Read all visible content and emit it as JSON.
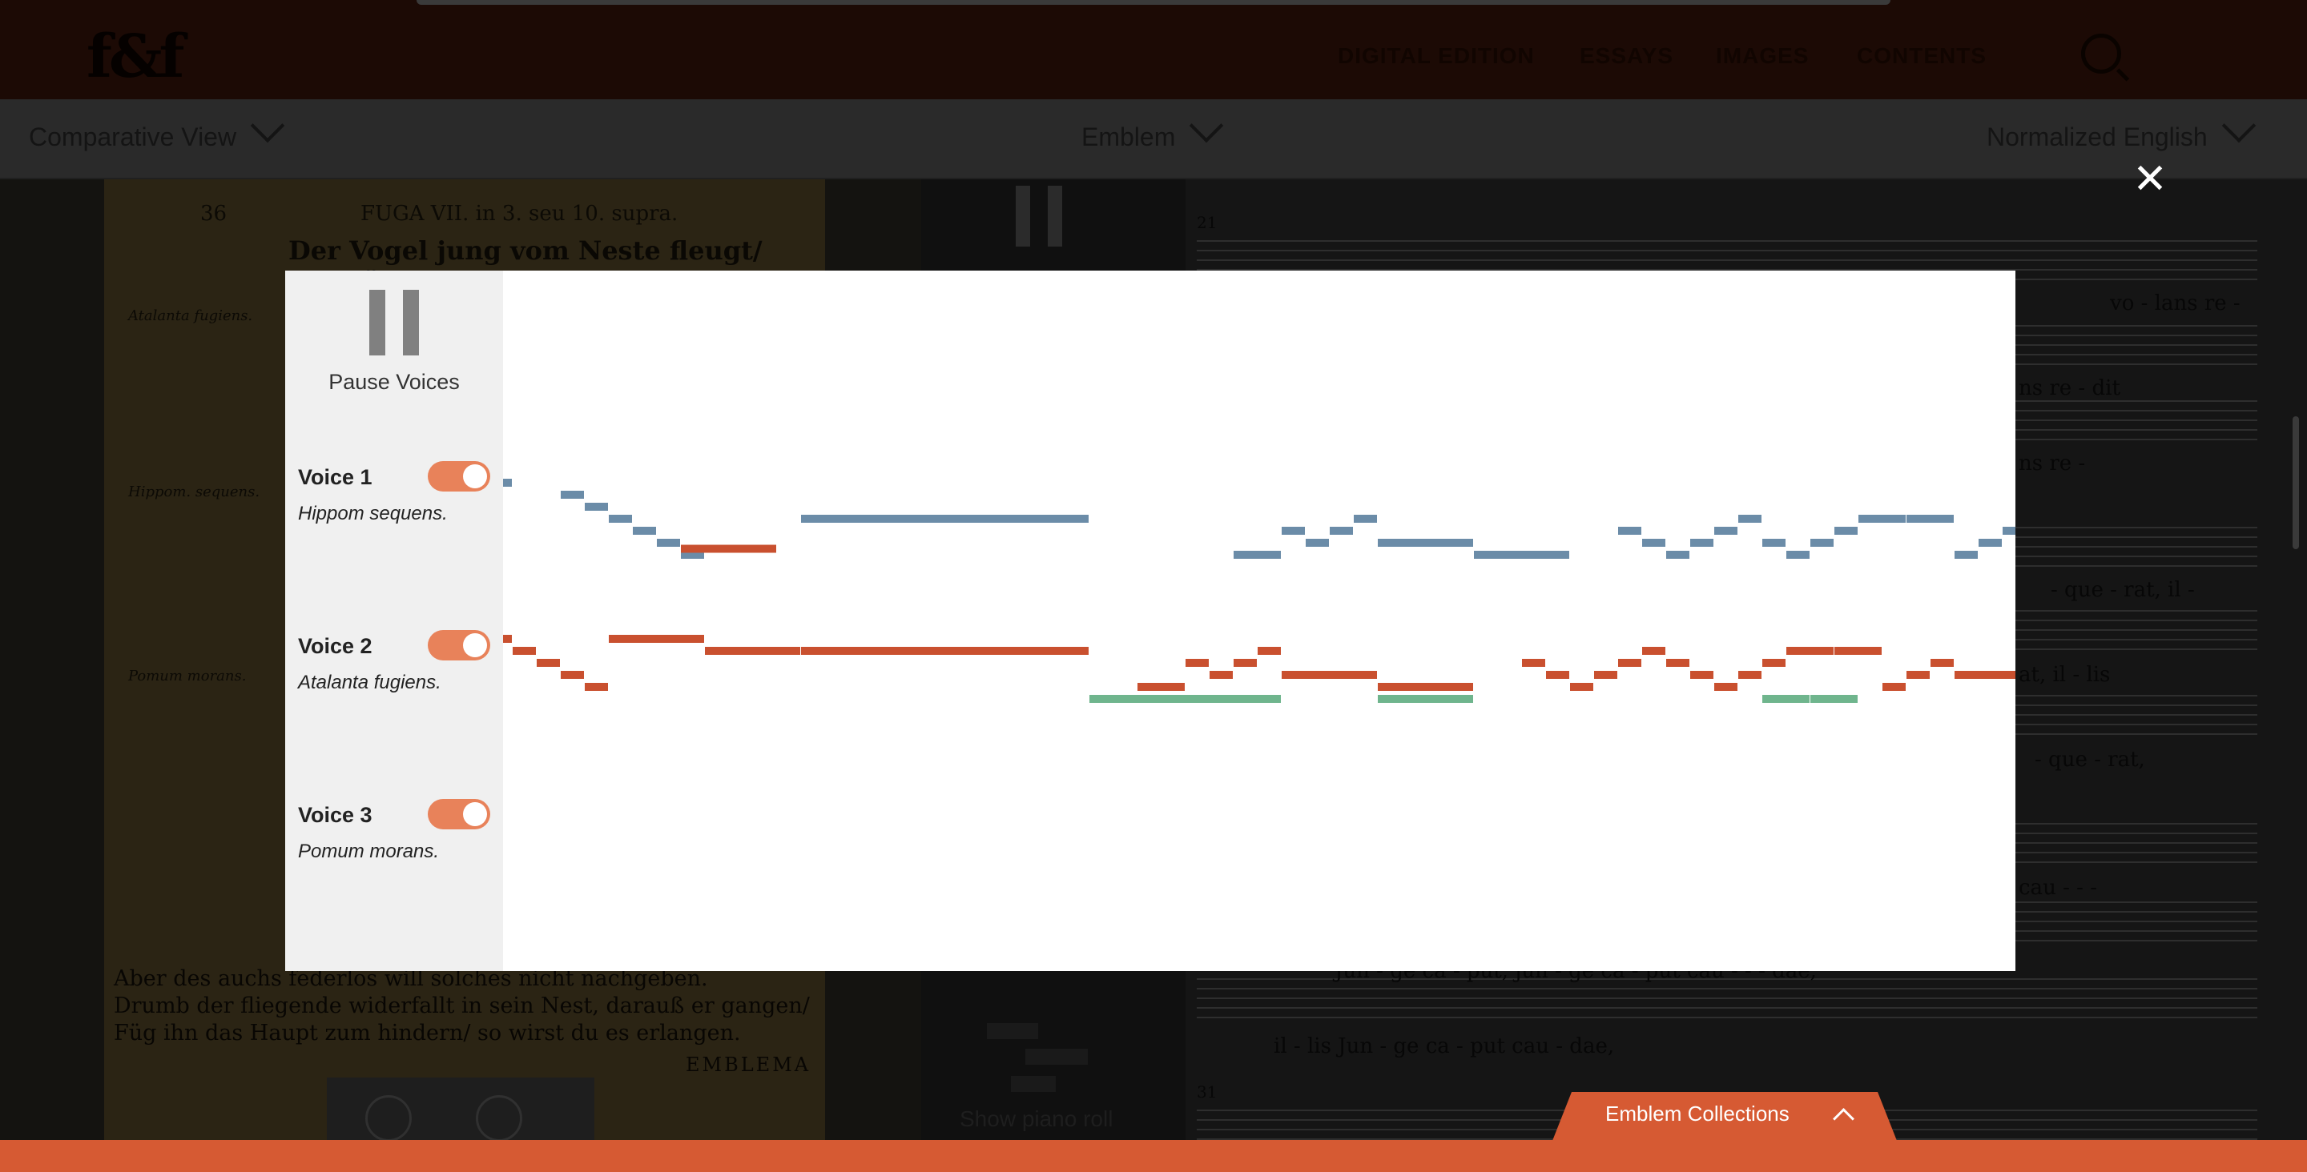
{
  "app": {
    "logo": "f&f",
    "nav": [
      "DIGITAL EDITION",
      "ESSAYS",
      "IMAGES",
      "CONTENTS"
    ]
  },
  "toolbar": {
    "view_select": "Comparative View",
    "section_select": "Emblem",
    "language_select": "Normalized English"
  },
  "manuscript": {
    "header": "FUGA VII. in 3. seu 10. supra.",
    "title_line": "Der Vogel jung vom Neste fleugt/ und fällt",
    "page_number": "36",
    "emblema": "EMBLEMA",
    "voice_labels": [
      "Atalanta fugiens.",
      "Hippom. sequens.",
      "Pomum morans."
    ],
    "verse_lines": [
      "Aber des auchs federlos will solches nicht nachgeben.",
      "Drumb der fliegende widerfallt in sein Nest, darauß er gangen/",
      "Füg ihn das Haupt zum hindern/ so wirst du es erlangen."
    ]
  },
  "score": {
    "measure_numbers": [
      "21",
      "31"
    ],
    "lyric_lines": [
      "vo - lans re -",
      "ns re - dit",
      "ns re -",
      "- que - rat, il -",
      "at, il - lis",
      "- que - rat,",
      "cau - - -",
      "Jun - ge ca - put, jun - ge ca - put cau - - - dae,",
      "il - lis Jun - ge ca - put cau - dae,"
    ]
  },
  "piano_roll_toggle": "Show piano roll",
  "footer": {
    "collections": "Emblem Collections"
  },
  "modal": {
    "pause_label": "Pause Voices",
    "voices": [
      {
        "name": "Voice 1",
        "subtitle": "Hippom sequens.",
        "enabled": true,
        "color": "#6b8ca8"
      },
      {
        "name": "Voice 2",
        "subtitle": "Atalanta fugiens.",
        "enabled": true,
        "color": "#c9502f"
      },
      {
        "name": "Voice 3",
        "subtitle": "Pomum morans.",
        "enabled": true,
        "color": "#6fb58d"
      }
    ]
  },
  "chart_data": {
    "type": "piano-roll",
    "time_unit": "eighth",
    "pitch_unit": "diatonic step (higher = higher pitch)",
    "series": [
      {
        "name": "Voice 1",
        "notes": [
          {
            "t": 0,
            "d": 0.4,
            "p": 13
          },
          {
            "t": 2.4,
            "d": 1,
            "p": 12
          },
          {
            "t": 3.4,
            "d": 1,
            "p": 11
          },
          {
            "t": 4.4,
            "d": 1,
            "p": 10
          },
          {
            "t": 5.4,
            "d": 1,
            "p": 9
          },
          {
            "t": 6.4,
            "d": 1,
            "p": 8
          },
          {
            "t": 7.4,
            "d": 1,
            "p": 7
          },
          {
            "t": 12.4,
            "d": 12,
            "p": 10
          },
          {
            "t": 30.4,
            "d": 2,
            "p": 7
          },
          {
            "t": 32.4,
            "d": 1,
            "p": 9
          },
          {
            "t": 33.4,
            "d": 1,
            "p": 8
          },
          {
            "t": 34.4,
            "d": 1,
            "p": 9
          },
          {
            "t": 35.4,
            "d": 1,
            "p": 10
          },
          {
            "t": 36.4,
            "d": 4,
            "p": 8
          },
          {
            "t": 40.4,
            "d": 4,
            "p": 7
          },
          {
            "t": 46.4,
            "d": 1,
            "p": 9
          },
          {
            "t": 47.4,
            "d": 1,
            "p": 8
          },
          {
            "t": 48.4,
            "d": 1,
            "p": 7
          },
          {
            "t": 49.4,
            "d": 1,
            "p": 8
          },
          {
            "t": 50.4,
            "d": 1,
            "p": 9
          },
          {
            "t": 51.4,
            "d": 1,
            "p": 10
          },
          {
            "t": 52.4,
            "d": 1,
            "p": 8
          },
          {
            "t": 53.4,
            "d": 1,
            "p": 7
          },
          {
            "t": 54.4,
            "d": 1,
            "p": 8
          },
          {
            "t": 55.4,
            "d": 1,
            "p": 9
          },
          {
            "t": 56.4,
            "d": 2,
            "p": 10
          },
          {
            "t": 58.4,
            "d": 2,
            "p": 10
          },
          {
            "t": 60.4,
            "d": 1,
            "p": 7
          },
          {
            "t": 61.4,
            "d": 1,
            "p": 8
          },
          {
            "t": 62.4,
            "d": 0.8,
            "p": 9
          }
        ]
      },
      {
        "name": "Voice 2",
        "notes": [
          {
            "t": 0,
            "d": 0.4,
            "p": 0
          },
          {
            "t": 0.4,
            "d": 1,
            "p": -1
          },
          {
            "t": 1.4,
            "d": 1,
            "p": -2
          },
          {
            "t": 2.4,
            "d": 1,
            "p": -3
          },
          {
            "t": 3.4,
            "d": 1,
            "p": -4
          },
          {
            "t": 4.4,
            "d": 4,
            "p": 0
          },
          {
            "t": 8.4,
            "d": 4,
            "p": -1
          },
          {
            "t": 12.4,
            "d": 12,
            "p": -1
          },
          {
            "t": 7.4,
            "d": 4,
            "p": 7.5
          },
          {
            "t": 26.4,
            "d": 2,
            "p": -4
          },
          {
            "t": 28.4,
            "d": 1,
            "p": -2
          },
          {
            "t": 29.4,
            "d": 1,
            "p": -3
          },
          {
            "t": 30.4,
            "d": 1,
            "p": -2
          },
          {
            "t": 31.4,
            "d": 1,
            "p": -1
          },
          {
            "t": 32.4,
            "d": 4,
            "p": -3
          },
          {
            "t": 36.4,
            "d": 4,
            "p": -4
          },
          {
            "t": 42.4,
            "d": 1,
            "p": -2
          },
          {
            "t": 43.4,
            "d": 1,
            "p": -3
          },
          {
            "t": 44.4,
            "d": 1,
            "p": -4
          },
          {
            "t": 45.4,
            "d": 1,
            "p": -3
          },
          {
            "t": 46.4,
            "d": 1,
            "p": -2
          },
          {
            "t": 47.4,
            "d": 1,
            "p": -1
          },
          {
            "t": 48.4,
            "d": 1,
            "p": -2
          },
          {
            "t": 49.4,
            "d": 1,
            "p": -3
          },
          {
            "t": 50.4,
            "d": 1,
            "p": -4
          },
          {
            "t": 51.4,
            "d": 1,
            "p": -3
          },
          {
            "t": 52.4,
            "d": 1,
            "p": -2
          },
          {
            "t": 53.4,
            "d": 2,
            "p": -1
          },
          {
            "t": 55.4,
            "d": 2,
            "p": -1
          },
          {
            "t": 57.4,
            "d": 1,
            "p": -4
          },
          {
            "t": 58.4,
            "d": 1,
            "p": -3
          },
          {
            "t": 59.4,
            "d": 1,
            "p": -2
          },
          {
            "t": 60.4,
            "d": 2.8,
            "p": -3
          }
        ]
      },
      {
        "name": "Voice 3",
        "notes": [
          {
            "t": 24.4,
            "d": 8,
            "p": -5
          },
          {
            "t": 36.4,
            "d": 4,
            "p": -5
          },
          {
            "t": 52.4,
            "d": 2,
            "p": -5
          },
          {
            "t": 54.4,
            "d": 2,
            "p": -5
          }
        ]
      }
    ]
  }
}
